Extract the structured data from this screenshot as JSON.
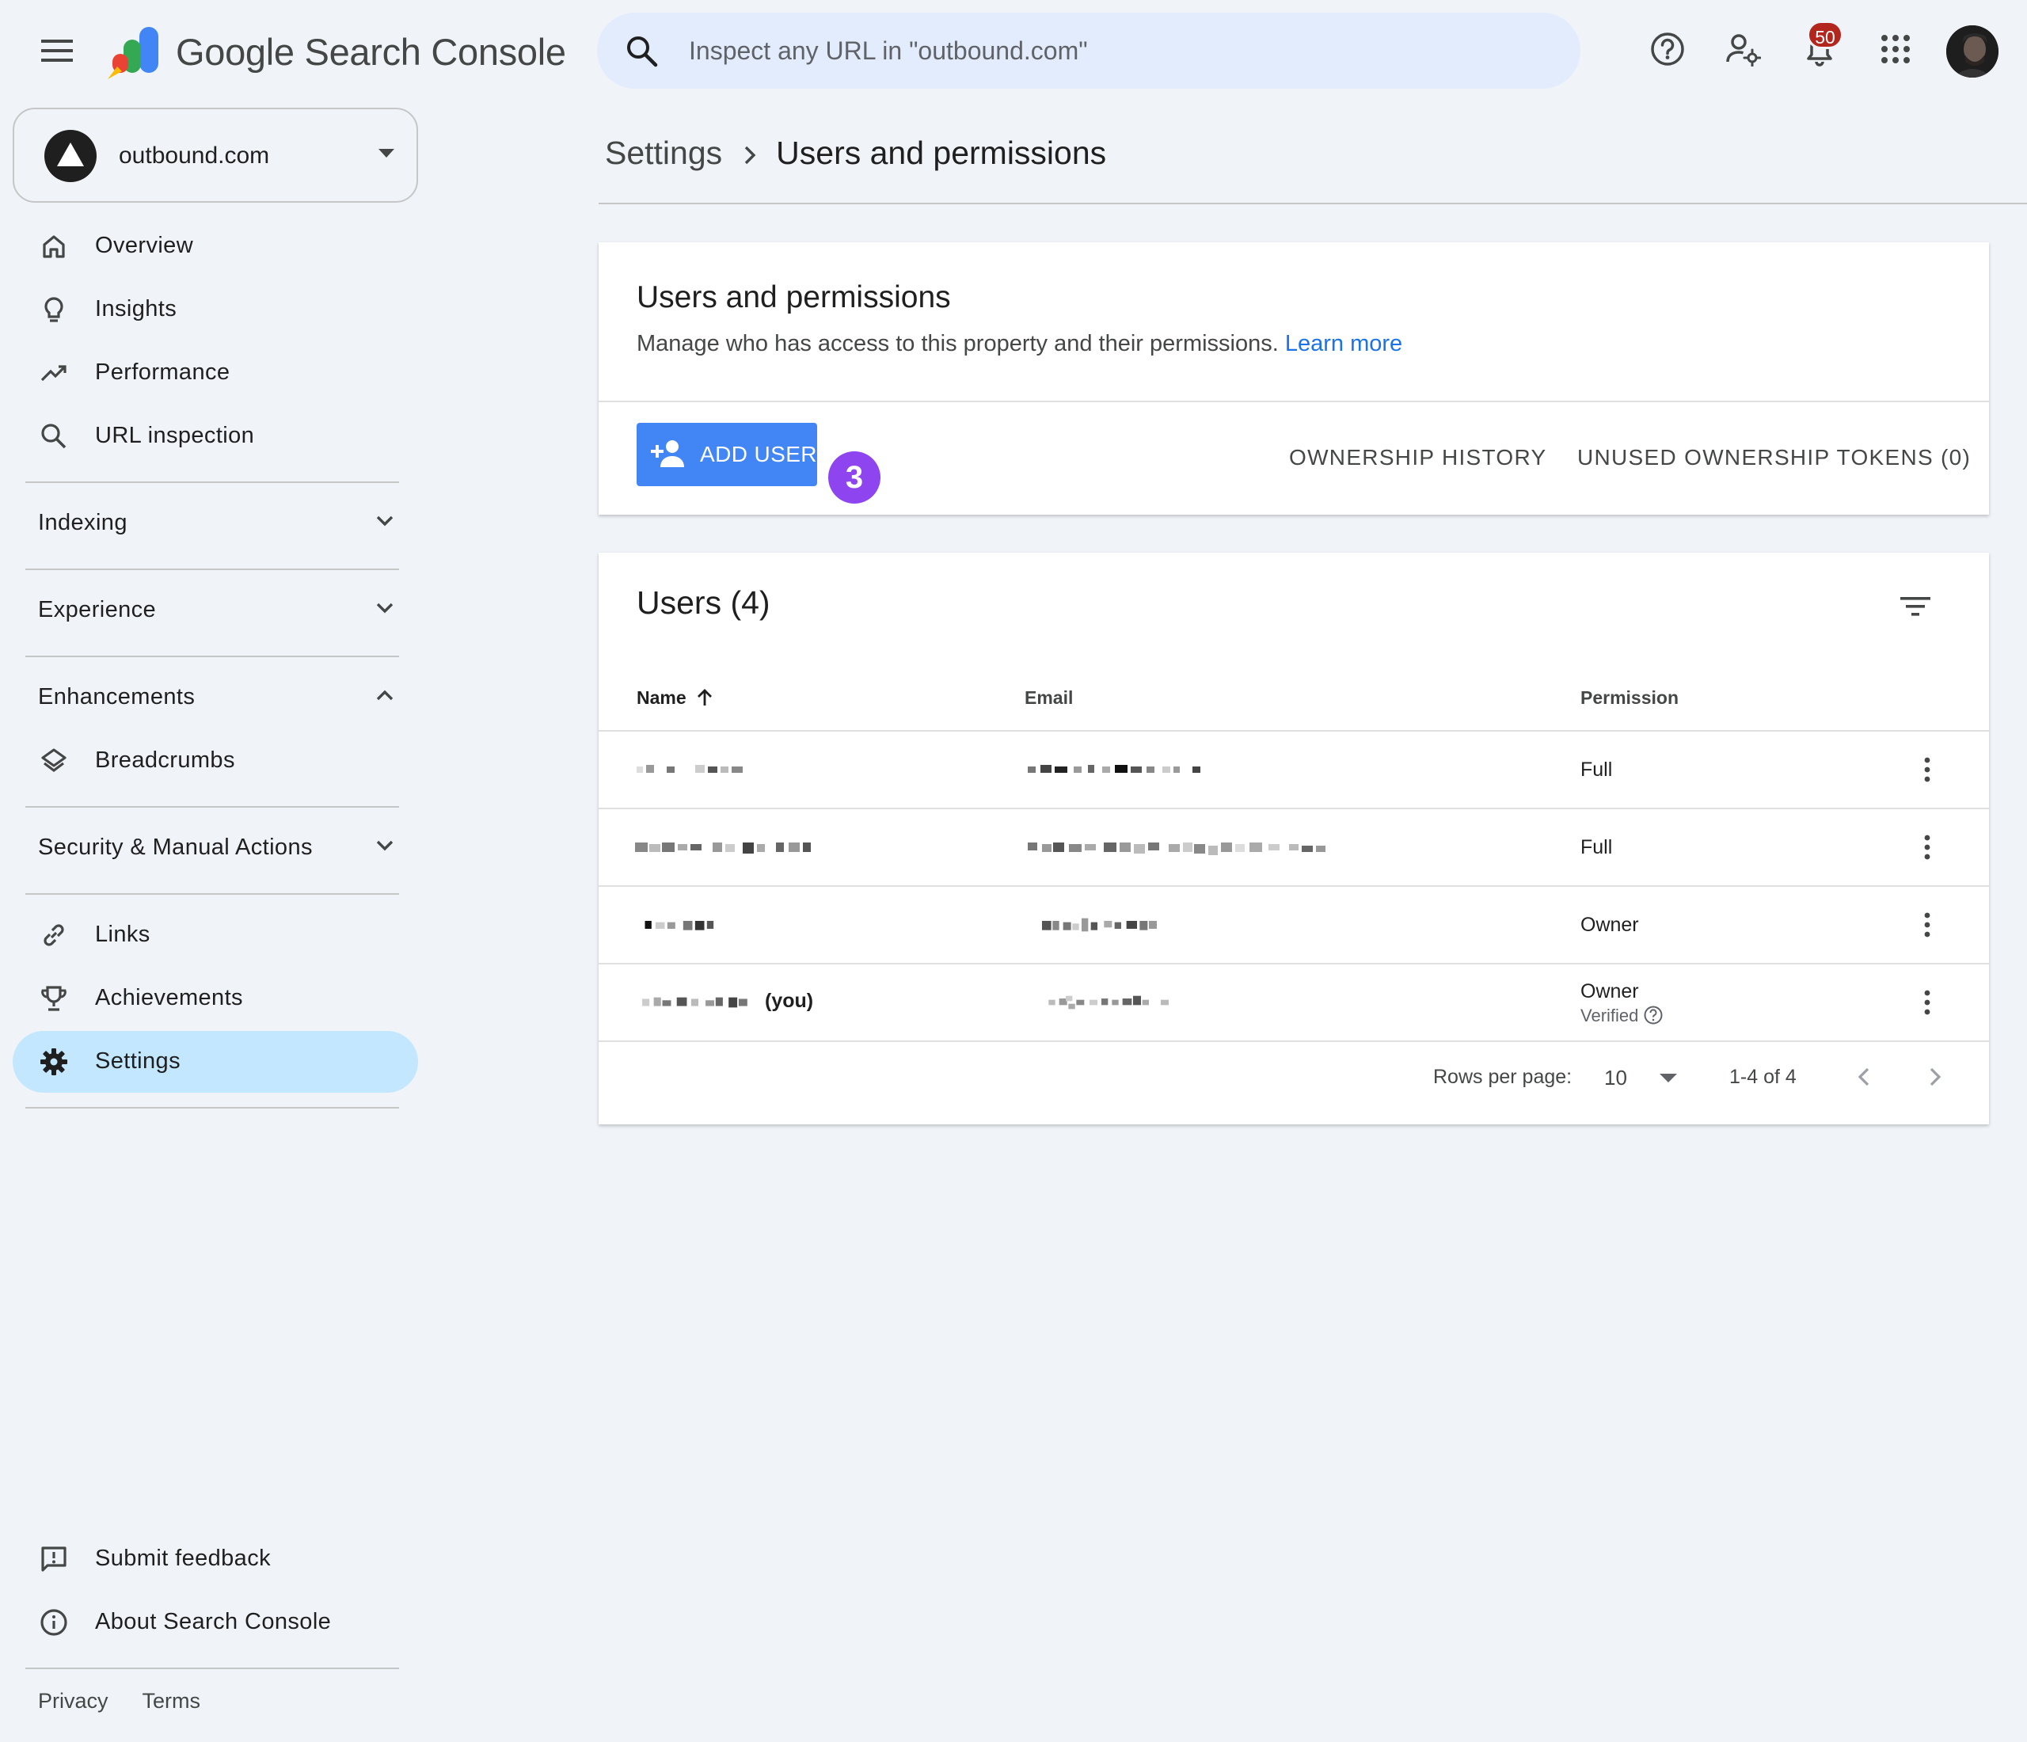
{
  "header": {
    "product_name": "Google Search Console",
    "search_placeholder": "Inspect any URL in \"outbound.com\"",
    "notifications_count": "50"
  },
  "sidebar": {
    "property": "outbound.com",
    "top_items": [
      {
        "label": "Overview",
        "icon": "home-icon"
      },
      {
        "label": "Insights",
        "icon": "lightbulb-icon"
      },
      {
        "label": "Performance",
        "icon": "trending-up-icon"
      },
      {
        "label": "URL inspection",
        "icon": "search-icon"
      }
    ],
    "sections": {
      "indexing": "Indexing",
      "experience": "Experience",
      "enhancements": "Enhancements",
      "security": "Security & Manual Actions"
    },
    "enhancement_items": [
      {
        "label": "Breadcrumbs",
        "icon": "layers-icon"
      }
    ],
    "bottom_items": [
      {
        "label": "Links",
        "icon": "link-icon"
      },
      {
        "label": "Achievements",
        "icon": "trophy-icon"
      },
      {
        "label": "Settings",
        "icon": "gear-icon",
        "active": true
      }
    ],
    "feedback_items": [
      {
        "label": "Submit feedback",
        "icon": "feedback-icon"
      },
      {
        "label": "About Search Console",
        "icon": "info-icon"
      }
    ],
    "footer": {
      "privacy": "Privacy",
      "terms": "Terms"
    }
  },
  "breadcrumb": {
    "parent": "Settings",
    "current": "Users and permissions"
  },
  "permissions_card": {
    "title": "Users and permissions",
    "description": "Manage who has access to this property and their permissions.",
    "learn_more": "Learn more",
    "add_user": "ADD USER",
    "step_badge": "3",
    "ownership_history": "OWNERSHIP HISTORY",
    "unused_tokens": "UNUSED OWNERSHIP TOKENS (0)"
  },
  "users_card": {
    "title": "Users (4)",
    "columns": {
      "name": "Name",
      "email": "Email",
      "permission": "Permission"
    },
    "rows": [
      {
        "permission": "Full",
        "sub": "",
        "you": ""
      },
      {
        "permission": "Full",
        "sub": "",
        "you": ""
      },
      {
        "permission": "Owner",
        "sub": "",
        "you": ""
      },
      {
        "permission": "Owner",
        "sub": "Verified",
        "you": "(you)"
      }
    ],
    "pagination": {
      "rows_per_page_label": "Rows per page:",
      "rows_per_page": "10",
      "range": "1-4 of 4"
    }
  },
  "colors": {
    "accent": "#4285f4",
    "active_nav": "#c2e7ff",
    "badge": "#8e44ef",
    "notification": "#b3261e",
    "link": "#1a73e8"
  }
}
